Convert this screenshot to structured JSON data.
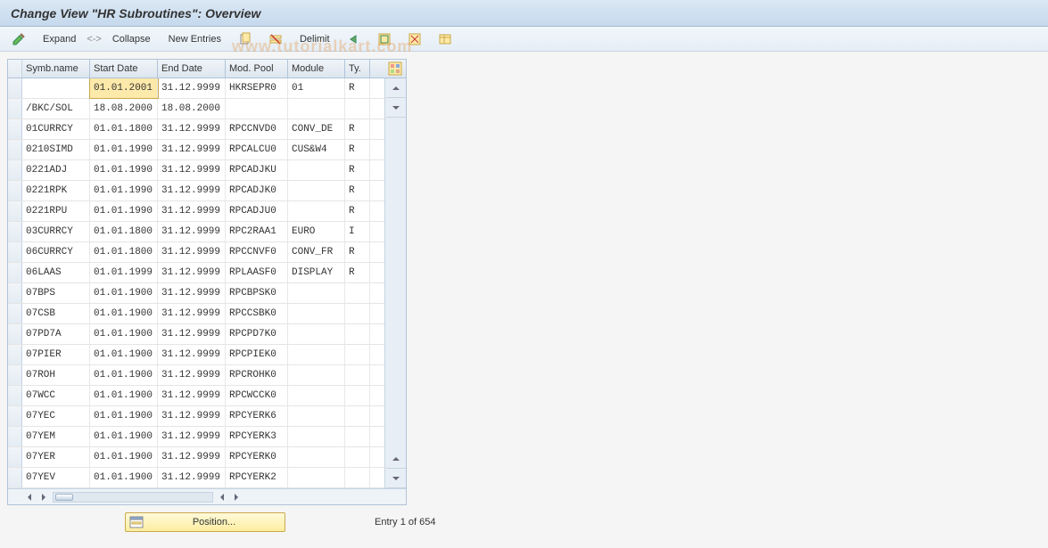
{
  "title": "Change View \"HR Subroutines\": Overview",
  "toolbar": {
    "expand": "Expand",
    "sep": "<->",
    "collapse": "Collapse",
    "newEntries": "New Entries",
    "delimit": "Delimit"
  },
  "table": {
    "headers": {
      "symb": "Symb.name",
      "start": "Start Date",
      "end": "End Date",
      "mod": "Mod. Pool",
      "module": "Module",
      "ty": "Ty."
    },
    "rows": [
      {
        "symb": "",
        "start": "01.01.2001",
        "end": "31.12.9999",
        "mod": "HKRSEPR0",
        "module": "01",
        "ty": "R",
        "sel": true
      },
      {
        "symb": "/BKC/SOL",
        "start": "18.08.2000",
        "end": "18.08.2000",
        "mod": "",
        "module": "",
        "ty": ""
      },
      {
        "symb": "01CURRCY",
        "start": "01.01.1800",
        "end": "31.12.9999",
        "mod": "RPCCNVD0",
        "module": "CONV_DE",
        "ty": "R"
      },
      {
        "symb": "0210SIMD",
        "start": "01.01.1990",
        "end": "31.12.9999",
        "mod": "RPCALCU0",
        "module": "CUS&W4",
        "ty": "R"
      },
      {
        "symb": "0221ADJ",
        "start": "01.01.1990",
        "end": "31.12.9999",
        "mod": "RPCADJKU",
        "module": "",
        "ty": "R"
      },
      {
        "symb": "0221RPK",
        "start": "01.01.1990",
        "end": "31.12.9999",
        "mod": "RPCADJK0",
        "module": "",
        "ty": "R"
      },
      {
        "symb": "0221RPU",
        "start": "01.01.1990",
        "end": "31.12.9999",
        "mod": "RPCADJU0",
        "module": "",
        "ty": "R"
      },
      {
        "symb": "03CURRCY",
        "start": "01.01.1800",
        "end": "31.12.9999",
        "mod": "RPC2RAA1",
        "module": "EURO",
        "ty": "I"
      },
      {
        "symb": "06CURRCY",
        "start": "01.01.1800",
        "end": "31.12.9999",
        "mod": "RPCCNVF0",
        "module": "CONV_FR",
        "ty": "R"
      },
      {
        "symb": "06LAAS",
        "start": "01.01.1999",
        "end": "31.12.9999",
        "mod": "RPLAASF0",
        "module": "DISPLAY",
        "ty": "R"
      },
      {
        "symb": "07BPS",
        "start": "01.01.1900",
        "end": "31.12.9999",
        "mod": "RPCBPSK0",
        "module": "",
        "ty": ""
      },
      {
        "symb": "07CSB",
        "start": "01.01.1900",
        "end": "31.12.9999",
        "mod": "RPCCSBK0",
        "module": "",
        "ty": ""
      },
      {
        "symb": "07PD7A",
        "start": "01.01.1900",
        "end": "31.12.9999",
        "mod": "RPCPD7K0",
        "module": "",
        "ty": ""
      },
      {
        "symb": "07PIER",
        "start": "01.01.1900",
        "end": "31.12.9999",
        "mod": "RPCPIEK0",
        "module": "",
        "ty": ""
      },
      {
        "symb": "07ROH",
        "start": "01.01.1900",
        "end": "31.12.9999",
        "mod": "RPCROHK0",
        "module": "",
        "ty": ""
      },
      {
        "symb": "07WCC",
        "start": "01.01.1900",
        "end": "31.12.9999",
        "mod": "RPCWCCK0",
        "module": "",
        "ty": ""
      },
      {
        "symb": "07YEC",
        "start": "01.01.1900",
        "end": "31.12.9999",
        "mod": "RPCYERK6",
        "module": "",
        "ty": ""
      },
      {
        "symb": "07YEM",
        "start": "01.01.1900",
        "end": "31.12.9999",
        "mod": "RPCYERK3",
        "module": "",
        "ty": ""
      },
      {
        "symb": "07YER",
        "start": "01.01.1900",
        "end": "31.12.9999",
        "mod": "RPCYERK0",
        "module": "",
        "ty": ""
      },
      {
        "symb": "07YEV",
        "start": "01.01.1900",
        "end": "31.12.9999",
        "mod": "RPCYERK2",
        "module": "",
        "ty": ""
      }
    ]
  },
  "footer": {
    "position": "Position...",
    "entry": "Entry 1 of 654"
  },
  "watermark": "www.tutorialkart.com"
}
